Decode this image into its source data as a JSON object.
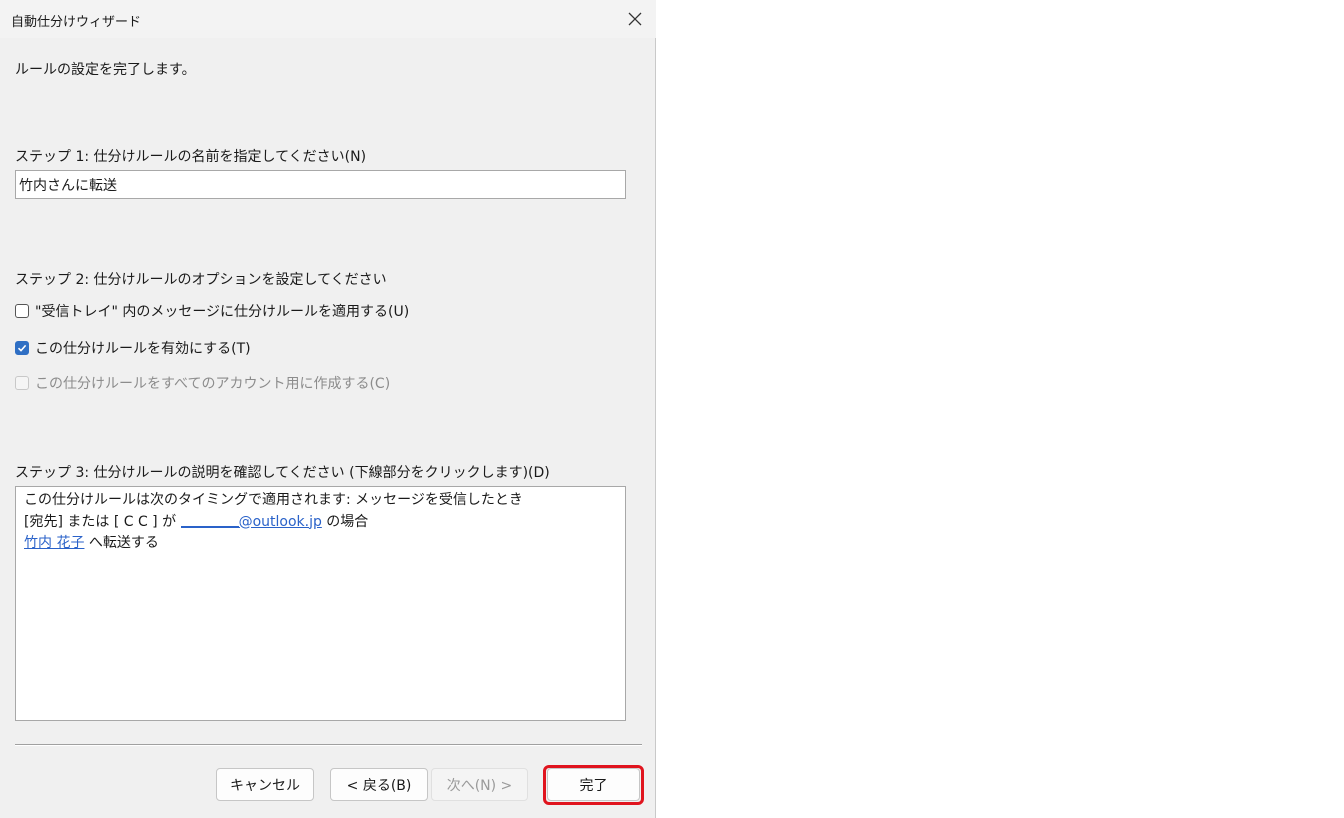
{
  "window": {
    "title": "自動仕分けウィザード"
  },
  "intro": "ルールの設定を完了します。",
  "step1": {
    "label": "ステップ 1: 仕分けルールの名前を指定してください(N)",
    "value": "竹内さんに転送"
  },
  "step2": {
    "label": "ステップ 2: 仕分けルールのオプションを設定してください",
    "options": [
      {
        "label": "\"受信トレイ\" 内のメッセージに仕分けルールを適用する(U)",
        "checked": false,
        "enabled": true
      },
      {
        "label": "この仕分けルールを有効にする(T)",
        "checked": true,
        "enabled": true
      },
      {
        "label": "この仕分けルールをすべてのアカウント用に作成する(C)",
        "checked": false,
        "enabled": false
      }
    ]
  },
  "step3": {
    "label": "ステップ 3: 仕分けルールの説明を確認してください (下線部分をクリックします)(D)",
    "line1": "この仕分けルールは次のタイミングで適用されます: メッセージを受信したとき",
    "line2_prefix": "[宛先] または [ C C ] が ",
    "line2_link": "@outlook.jp",
    "line2_suffix": " の場合",
    "line3_link": "竹内 花子",
    "line3_suffix": " へ転送する"
  },
  "buttons": {
    "cancel": "キャンセル",
    "back": "< 戻る(B)",
    "next": "次へ(N) >",
    "finish": "完了"
  },
  "colors": {
    "link": "#2a62c9",
    "checkbox_accent": "#2f6fc4",
    "highlight": "#e0141e"
  }
}
